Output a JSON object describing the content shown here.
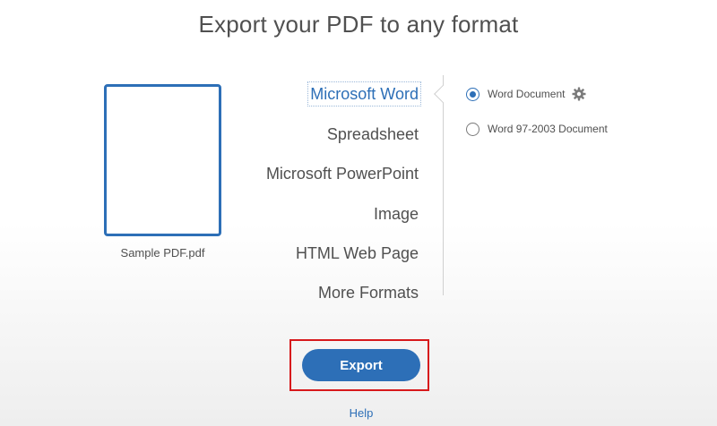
{
  "page": {
    "title": "Export your PDF to any format"
  },
  "file": {
    "name": "Sample PDF.pdf"
  },
  "formats": {
    "items": [
      {
        "label": "Microsoft Word",
        "selected": true
      },
      {
        "label": "Spreadsheet",
        "selected": false
      },
      {
        "label": "Microsoft PowerPoint",
        "selected": false
      },
      {
        "label": "Image",
        "selected": false
      },
      {
        "label": "HTML Web Page",
        "selected": false
      },
      {
        "label": "More Formats",
        "selected": false
      }
    ]
  },
  "options": {
    "items": [
      {
        "label": "Word Document",
        "checked": true,
        "has_settings": true,
        "settings_icon": "gear-icon"
      },
      {
        "label": "Word 97-2003 Document",
        "checked": false,
        "has_settings": false
      }
    ]
  },
  "actions": {
    "export_label": "Export",
    "help_label": "Help"
  },
  "colors": {
    "accent": "#2d6fb7",
    "highlight_box": "#d7191c",
    "text": "#505050"
  }
}
